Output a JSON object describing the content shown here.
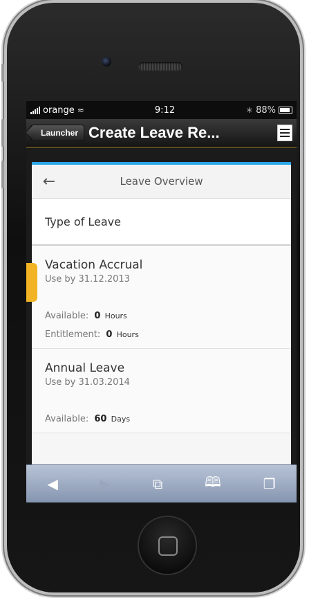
{
  "status_bar": {
    "carrier": "orange",
    "time": "9:12",
    "battery": "88%"
  },
  "nav_bar": {
    "back_label": "Launcher",
    "title": "Create Leave Re..."
  },
  "overview": {
    "title": "Leave Overview"
  },
  "type_of_leave": "Type of Leave",
  "leave_items": [
    {
      "title": "Vacation Accrual",
      "use_by": "Use by 31.12.2013",
      "available_label": "Available:",
      "available_value": "0",
      "available_unit": "Hours",
      "entitlement_label": "Entitlement:",
      "entitlement_value": "0",
      "entitlement_unit": "Hours"
    },
    {
      "title": "Annual Leave",
      "use_by": "Use by 31.03.2014",
      "available_label": "Available:",
      "available_value": "60",
      "available_unit": "Days"
    }
  ],
  "toolbar_icons": [
    "back-arrow-icon",
    "forward-arrow-icon",
    "share-icon",
    "bookmarks-icon",
    "tabs-icon"
  ],
  "colors": {
    "accent_blue": "#2aa6e8",
    "side_tab": "#f2b424"
  }
}
